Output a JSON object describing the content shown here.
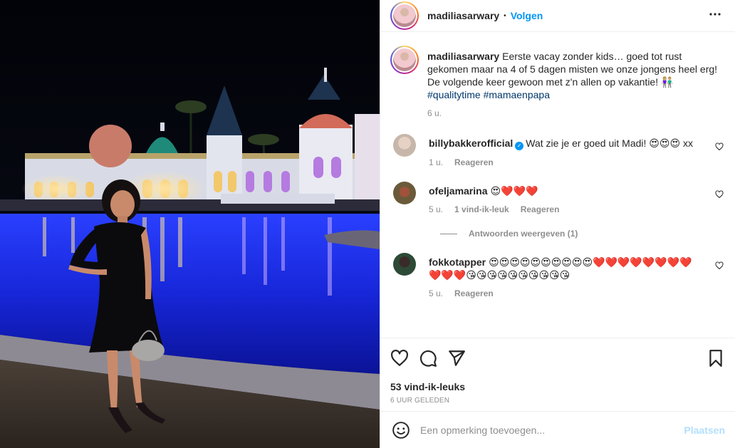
{
  "post": {
    "username": "madiliasarwary",
    "follow_label": "Volgen",
    "separator": "•",
    "more_label": "•••"
  },
  "caption": {
    "username": "madiliasarwary",
    "text": "Eerste vacay zonder kids… goed tot rust gekomen maar na 4 of 5 dagen misten we onze jongens heel erg! De volgende keer gewoon met z'n allen op vakantie! 👫🏼",
    "tags": "#qualitytime #mamaenpapa",
    "time": "6 u."
  },
  "comments": [
    {
      "username": "billybakkerofficial",
      "verified": true,
      "text": "Wat zie je er goed uit Madi! 😍😍😍 xx",
      "time": "1 u.",
      "reply_label": "Reageren"
    },
    {
      "username": "ofeljamarina",
      "text": "😍❤️❤️❤️",
      "time": "5 u.",
      "likes_label": "1 vind-ik-leuk",
      "reply_label": "Reageren",
      "view_replies_label": "Antwoorden weergeven (1)"
    },
    {
      "username": "fokkotapper",
      "text": "😍😍😍😍😍😍😍😍😍😍❤️❤️❤️❤️❤️❤️❤️❤️❤️❤️❤️😘😘😘😘😘😘😘😘😘😘",
      "time": "5 u.",
      "reply_label": "Reageren"
    }
  ],
  "stats": {
    "likes": "53 vind-ik-leuks",
    "posted": "6 UUR GELEDEN"
  },
  "add_comment": {
    "placeholder": "Een opmerking toevoegen...",
    "post_label": "Plaatsen"
  },
  "colors": {
    "accent": "#0095f6",
    "post_disabled": "#b2dffc",
    "muted": "#8e8e8e",
    "pool": "#1a2cff"
  },
  "icons": [
    "more-options-icon",
    "heart-icon",
    "comment-icon",
    "share-icon",
    "bookmark-icon",
    "emoji-icon",
    "verified-icon"
  ]
}
